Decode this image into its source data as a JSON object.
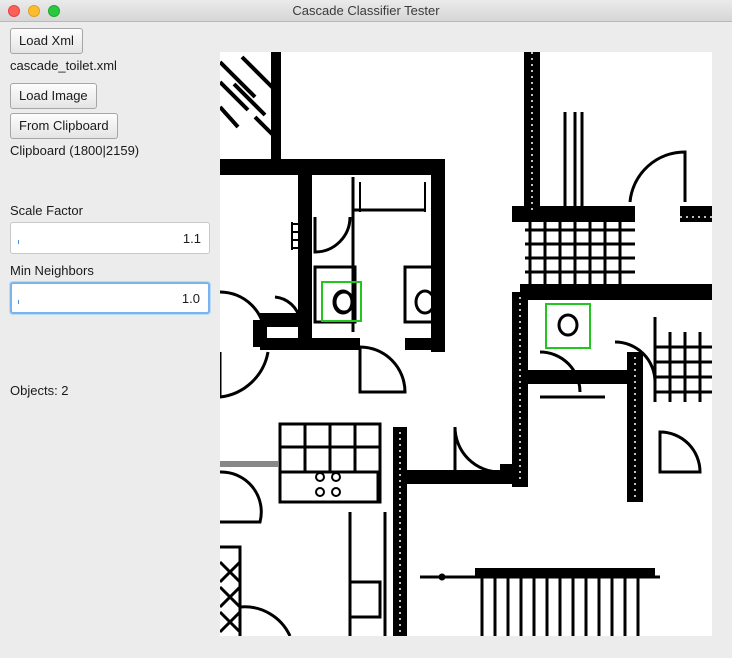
{
  "window": {
    "title": "Cascade Classifier Tester"
  },
  "buttons": {
    "load_xml": "Load Xml",
    "load_image": "Load Image",
    "from_clipboard": "From Clipboard"
  },
  "status": {
    "xml_file": "cascade_toilet.xml",
    "clipboard_info": "Clipboard (1800|2159)",
    "objects": "Objects: 2"
  },
  "params": {
    "scale_factor_label": "Scale Factor",
    "scale_factor_value": "1.1",
    "min_neighbors_label": "Min Neighbors",
    "min_neighbors_value": "1.0"
  },
  "detection": {
    "count": 2,
    "box_color": "#22c61e"
  },
  "colors": {
    "focus": "#79b5ec",
    "window_bg": "#ececec"
  }
}
